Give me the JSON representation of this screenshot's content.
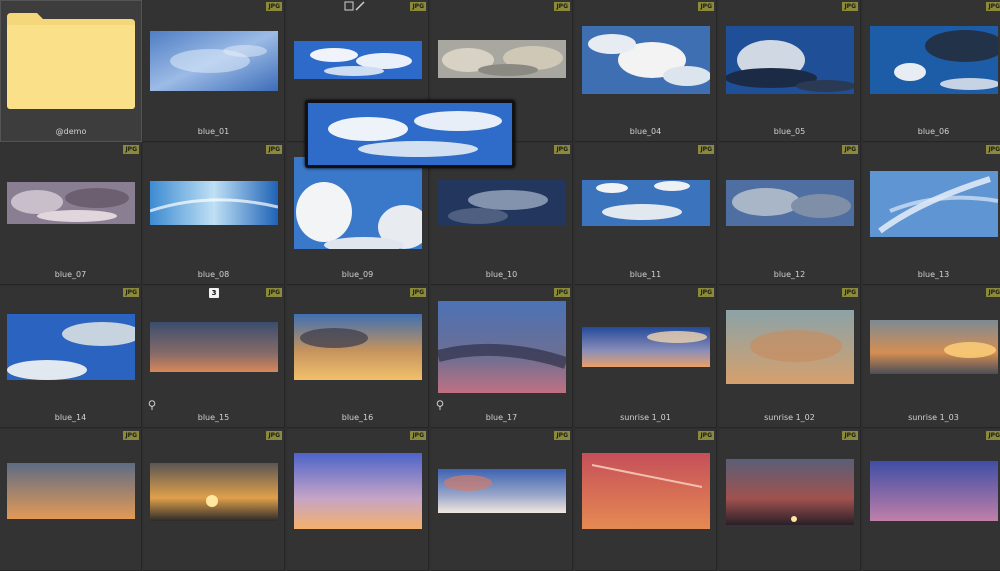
{
  "folder": {
    "label": "@demo",
    "icon": "folder-icon"
  },
  "badge_text": "JPG",
  "colors": {
    "background": "#2f2f2f",
    "cell": "#333333",
    "badge": "#8a8a3a",
    "label": "#d2d2d2"
  },
  "items": [
    {
      "label": "blue_01",
      "badge": true
    },
    {
      "label": "",
      "badge": true,
      "icons": [
        "checkbox-icon",
        "edit-icon"
      ]
    },
    {
      "label": "",
      "badge": true
    },
    {
      "label": "blue_04",
      "badge": true
    },
    {
      "label": "blue_05",
      "badge": true
    },
    {
      "label": "blue_06",
      "badge": true
    },
    {
      "label": "blue_07",
      "badge": true
    },
    {
      "label": "blue_08",
      "badge": true
    },
    {
      "label": "blue_09",
      "badge": true
    },
    {
      "label": "blue_10",
      "badge": true
    },
    {
      "label": "blue_11",
      "badge": true
    },
    {
      "label": "blue_12",
      "badge": true
    },
    {
      "label": "blue_13",
      "badge": true
    },
    {
      "label": "blue_14",
      "badge": true
    },
    {
      "label": "blue_15",
      "badge": true,
      "count": "3",
      "pin": true
    },
    {
      "label": "blue_16",
      "badge": true
    },
    {
      "label": "blue_17",
      "badge": true,
      "pin": true
    },
    {
      "label": "sunrise 1_01",
      "badge": true
    },
    {
      "label": "sunrise 1_02",
      "badge": true
    },
    {
      "label": "sunrise 1_03",
      "badge": true
    },
    {
      "label": "",
      "badge": true
    },
    {
      "label": "",
      "badge": true
    },
    {
      "label": "",
      "badge": true
    },
    {
      "label": "",
      "badge": true
    },
    {
      "label": "",
      "badge": true
    },
    {
      "label": "",
      "badge": true
    },
    {
      "label": "",
      "badge": true
    }
  ]
}
